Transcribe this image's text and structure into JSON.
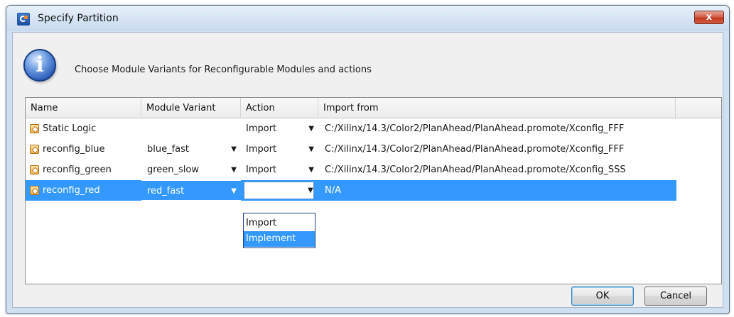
{
  "window": {
    "title": "Specify Partition",
    "close_label": "x"
  },
  "message": {
    "text": "Choose Module Variants for Reconfigurable Modules and actions"
  },
  "table": {
    "columns": [
      "Name",
      "Module Variant",
      "Action",
      "Import from"
    ],
    "rows": [
      {
        "name": "Static Logic",
        "module_variant": "",
        "action": "Import",
        "import_from": "C:/Xilinx/14.3/Color2/PlanAhead/PlanAhead.promote/Xconfig_FFF"
      },
      {
        "name": "reconfig_blue",
        "module_variant": "blue_fast",
        "action": "Import",
        "import_from": "C:/Xilinx/14.3/Color2/PlanAhead/PlanAhead.promote/Xconfig_FFF"
      },
      {
        "name": "reconfig_green",
        "module_variant": "green_slow",
        "action": "Import",
        "import_from": "C:/Xilinx/14.3/Color2/PlanAhead/PlanAhead.promote/Xconfig_SSS"
      },
      {
        "name": "reconfig_red",
        "module_variant": "red_fast",
        "action": "",
        "import_from": "N/A"
      }
    ],
    "selected_row": 3
  },
  "action_dropdown": {
    "options": [
      "Import",
      "Implement"
    ],
    "highlighted": "Implement"
  },
  "buttons": {
    "ok": "OK",
    "cancel": "Cancel"
  },
  "colors": {
    "selection": "#3399ff",
    "title_bar": "#d4e3f4",
    "close_button": "#c23a22"
  }
}
